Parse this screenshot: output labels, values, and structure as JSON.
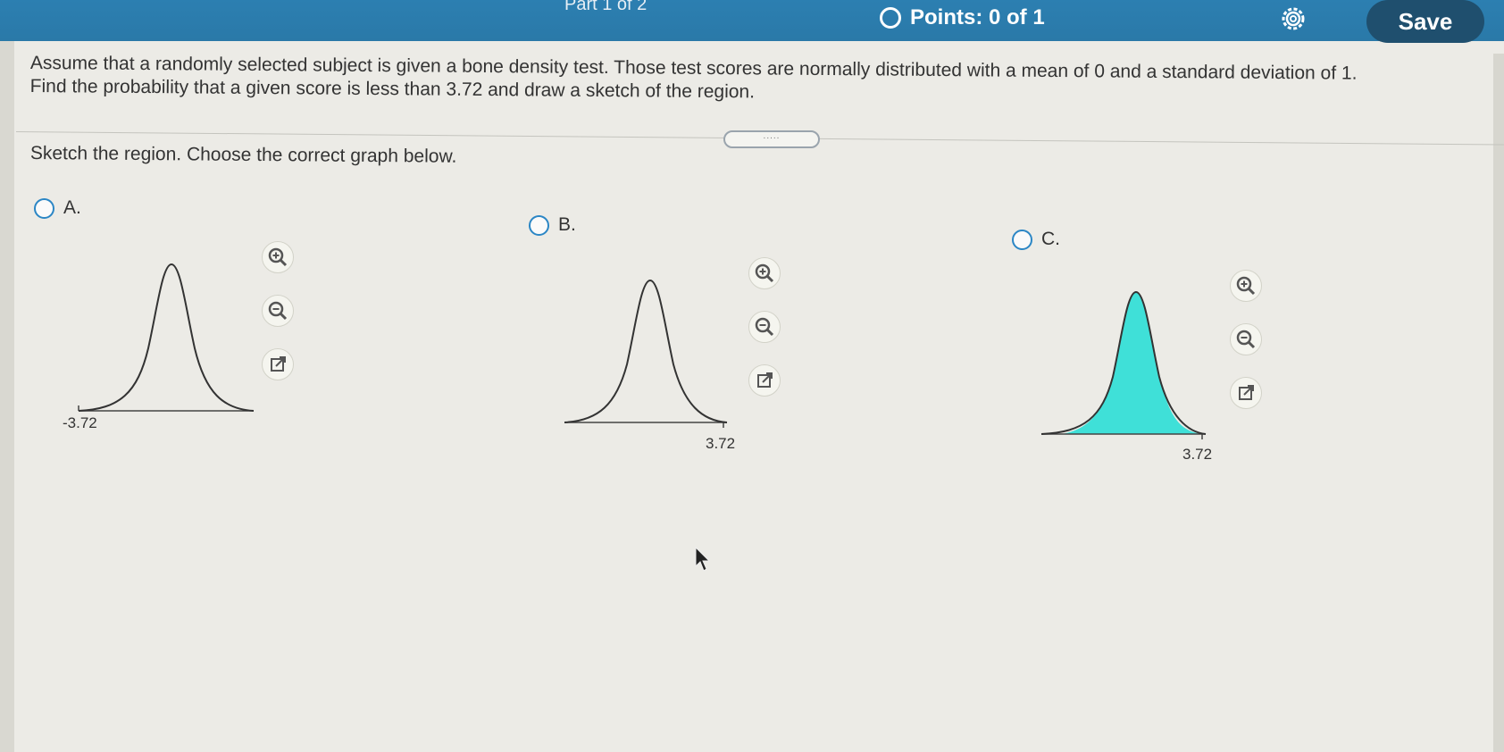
{
  "header": {
    "part": "Part 1 of 2",
    "points": "Points: 0 of 1",
    "save_label": "Save"
  },
  "question": {
    "line1": "Assume that a randomly selected subject is given a bone density test. Those test scores are normally distributed with a mean of 0 and a standard deviation of 1.",
    "line2": "Find the probability that a given score is less than 3.72 and draw a sketch of the region.",
    "handle_dots": ".....",
    "prompt": "Sketch the region. Choose the correct graph below."
  },
  "options": [
    {
      "label": "A.",
      "tick": "-3.72",
      "shaded": false
    },
    {
      "label": "B.",
      "tick": "3.72",
      "shaded": false
    },
    {
      "label": "C.",
      "tick": "3.72",
      "shaded": true
    }
  ],
  "colors": {
    "accent": "#2b86c5",
    "header": "#2c7fb1",
    "shade": "#3fe0d8"
  },
  "icons": [
    "gear-icon",
    "zoom-in-icon",
    "zoom-out-icon",
    "open-external-icon"
  ]
}
